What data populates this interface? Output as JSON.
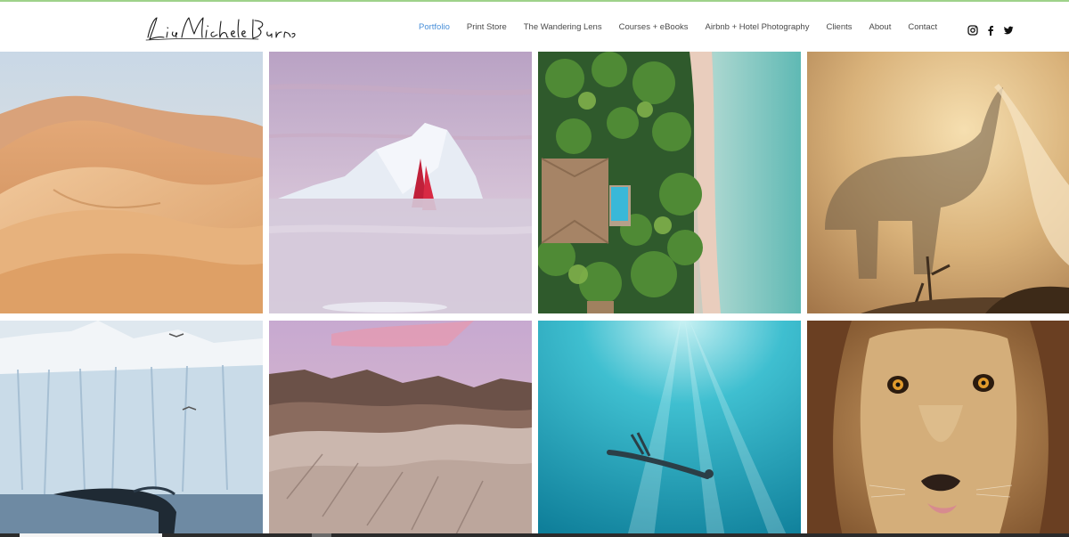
{
  "header": {
    "logo_text": "Lisa Michele Burns",
    "nav": [
      {
        "label": "Portfolio",
        "active": true
      },
      {
        "label": "Print Store",
        "active": false
      },
      {
        "label": "The Wandering Lens",
        "active": false
      },
      {
        "label": "Courses + eBooks",
        "active": false
      },
      {
        "label": "Airbnb + Hotel Photography",
        "active": false
      },
      {
        "label": "Clients",
        "active": false
      },
      {
        "label": "About",
        "active": false
      },
      {
        "label": "Contact",
        "active": false
      }
    ],
    "social_icons": [
      "instagram-icon",
      "facebook-icon",
      "twitter-icon"
    ]
  },
  "gallery": {
    "tiles": [
      {
        "subject": "desert-dunes"
      },
      {
        "subject": "iceberg-red-sailboat"
      },
      {
        "subject": "aerial-tropical-villa-beach"
      },
      {
        "subject": "elephant-dust"
      },
      {
        "subject": "glacier-whale-tail"
      },
      {
        "subject": "pink-sky-badlands"
      },
      {
        "subject": "underwater-swimmer"
      },
      {
        "subject": "lion-face"
      }
    ]
  },
  "colors": {
    "accent": "#4a90d9",
    "nav_text": "#4a4a4a",
    "top_line": "#9ed28a"
  }
}
